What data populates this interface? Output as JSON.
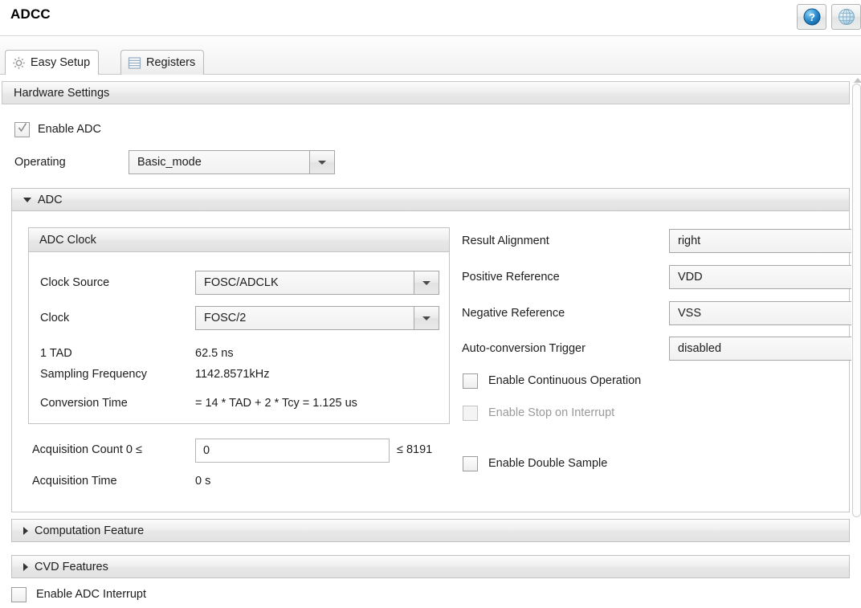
{
  "window": {
    "title": "ADCC",
    "help_button_icon": "help-circle-icon",
    "globe_button_icon": "globe-icon"
  },
  "tabs": [
    {
      "id": "easy-setup",
      "label": "Easy Setup",
      "icon": "gear-icon",
      "active": true
    },
    {
      "id": "registers",
      "label": "Registers",
      "icon": "registers-list-icon",
      "active": false
    }
  ],
  "hardware_settings": {
    "header": "Hardware Settings",
    "enable_adc": {
      "label": "Enable ADC",
      "checked": true
    },
    "operating": {
      "label": "Operating",
      "value": "Basic_mode",
      "options": [
        "Basic_mode"
      ]
    }
  },
  "adc_section": {
    "title": "ADC",
    "expanded": true,
    "adc_clock_group": {
      "title": "ADC Clock",
      "clock_source": {
        "label": "Clock Source",
        "value": "FOSC/ADCLK",
        "options": [
          "FOSC/ADCLK"
        ]
      },
      "clock": {
        "label": "Clock",
        "value": "FOSC/2",
        "options": [
          "FOSC/2"
        ]
      },
      "info_rows": [
        {
          "label": "1 TAD",
          "value": "62.5 ns"
        },
        {
          "label": "Sampling Frequency",
          "value": "1142.8571kHz"
        },
        {
          "label": "Conversion Time",
          "value": "= 14 * TAD + 2 * Tcy = 1.125 us"
        }
      ]
    },
    "acquisition": {
      "count_label": "Acquisition Count 0  ≤",
      "count_value": "0",
      "count_max": "≤ 8191",
      "time_label": "Acquisition Time",
      "time_value": "0 s"
    },
    "right_fields": [
      {
        "label": "Result Alignment",
        "value": "right"
      },
      {
        "label": "Positive Reference",
        "value": "VDD"
      },
      {
        "label": "Negative Reference",
        "value": "VSS"
      },
      {
        "label": "Auto-conversion Trigger",
        "value": "disabled"
      }
    ],
    "right_checkboxes": [
      {
        "label": "Enable Continuous Operation",
        "checked": false,
        "disabled": false
      },
      {
        "label": "Enable Stop on Interrupt",
        "checked": false,
        "disabled": true
      },
      {
        "label": "Enable Double Sample",
        "checked": false,
        "disabled": false
      }
    ]
  },
  "collapsed_sections": [
    {
      "title": "Computation Feature",
      "expanded": false
    },
    {
      "title": "CVD Features",
      "expanded": false
    }
  ],
  "footer": {
    "enable_adc_interrupt": {
      "label": "Enable ADC Interrupt",
      "checked": false
    }
  },
  "colors": {
    "accent_blue": "#2a7fc1",
    "panel_border": "#c7c7c7",
    "text": "#1d1d1d",
    "disabled_text": "#9a9a9a"
  }
}
